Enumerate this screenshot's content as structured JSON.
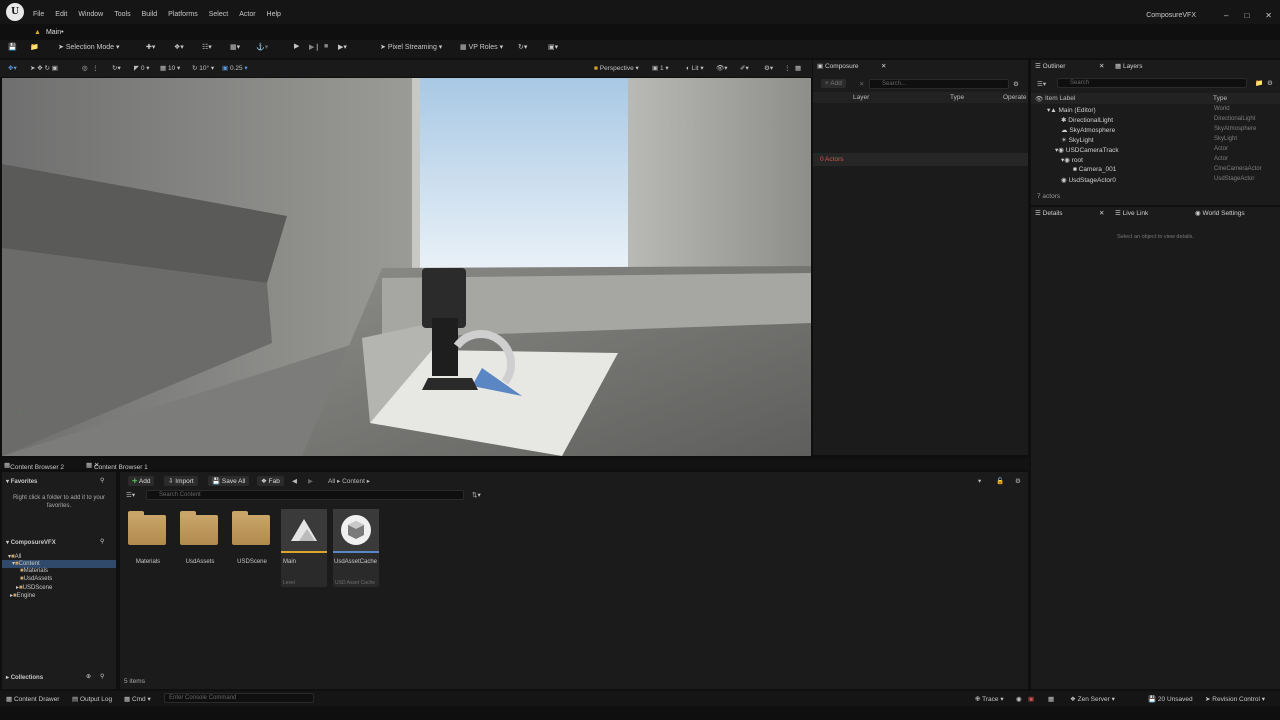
{
  "app": {
    "name": "ComposureVFX",
    "level_tab": "Main•"
  },
  "menu": [
    "File",
    "Edit",
    "Window",
    "Tools",
    "Build",
    "Platforms",
    "Select",
    "Actor",
    "Help"
  ],
  "toolbar": {
    "mode": "Selection Mode",
    "pixel_streaming": "Pixel Streaming",
    "vp_roles": "VP Roles"
  },
  "viewport_bar": {
    "snap_rot": "0",
    "snap_grid": "10",
    "snap_angle": "10°",
    "snap_scale": "0.25",
    "view": "Perspective",
    "view_count": "1",
    "lit": "Lit"
  },
  "composure": {
    "tab": "Composure",
    "add": "+ Add",
    "search_placeholder": "Search...",
    "cols": {
      "layer": "Layer",
      "type": "Type",
      "operate": "Operate"
    },
    "actors": "0 Actors"
  },
  "outliner": {
    "tab": "Outliner",
    "layers_tab": "Layers",
    "search_placeholder": "Search",
    "col_label": "Item Label",
    "col_type": "Type",
    "rows": [
      {
        "label": "Main (Editor)",
        "type": "World",
        "indent": 0
      },
      {
        "label": "DirectionalLight",
        "type": "DirectionalLight",
        "indent": 1
      },
      {
        "label": "SkyAtmosphere",
        "type": "SkyAtmosphere",
        "indent": 1
      },
      {
        "label": "SkyLight",
        "type": "SkyLight",
        "indent": 1
      },
      {
        "label": "USDCameraTrack",
        "type": "Actor",
        "indent": 1
      },
      {
        "label": "root",
        "type": "Actor",
        "indent": 2
      },
      {
        "label": "Camera_001",
        "type": "CineCameraActor",
        "indent": 3
      },
      {
        "label": "UsdStageActor0",
        "type": "UsdStageActor",
        "indent": 1
      }
    ],
    "count": "7 actors"
  },
  "details": {
    "tab": "Details",
    "live_link": "Live Link",
    "world_settings": "World Settings",
    "empty": "Select an object to view details."
  },
  "content_browser": {
    "tab2": "Content Browser 2",
    "tab1": "Content Browser 1",
    "add": "Add",
    "import": "Import",
    "save_all": "Save All",
    "fab": "Fab",
    "crumb_all": "All",
    "crumb_content": "Content",
    "search_placeholder": "Search Content",
    "favorites": "Favorites",
    "favorites_hint": "Right click a folder to add it to your favorites.",
    "project": "ComposureVFX",
    "tree": [
      "All",
      "Content",
      "Materials",
      "UsdAssets",
      "USDScene",
      "Engine"
    ],
    "collections": "Collections",
    "assets": [
      {
        "name": "Materials",
        "kind": "folder",
        "sub": ""
      },
      {
        "name": "UsdAssets",
        "kind": "folder",
        "sub": ""
      },
      {
        "name": "USDScene",
        "kind": "folder",
        "sub": ""
      },
      {
        "name": "Main",
        "kind": "level",
        "sub": "Level"
      },
      {
        "name": "UsdAssetCache",
        "kind": "asset",
        "sub": "USD Asset Cache"
      }
    ],
    "item_count": "5 items"
  },
  "status": {
    "content_drawer": "Content Drawer",
    "output_log": "Output Log",
    "cmd": "Cmd",
    "console_placeholder": "Enter Console Command",
    "trace": "Trace",
    "zen": "Zen Server",
    "unsaved": "20 Unsaved",
    "revision": "Revision Control"
  },
  "colors": {
    "accent_play": "#3fb24a",
    "selection": "#2f4a6a",
    "folder": "#c9a56a",
    "warning": "#d9534f"
  }
}
